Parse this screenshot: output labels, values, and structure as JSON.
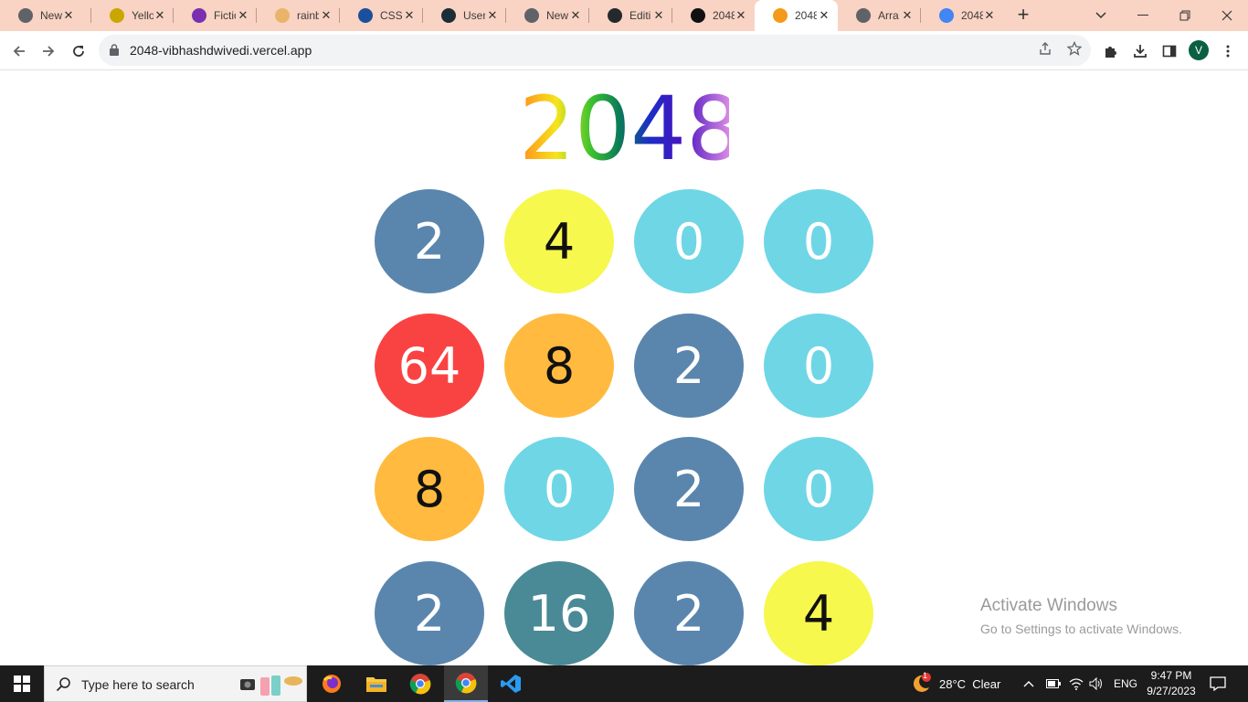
{
  "browser": {
    "tabs": [
      {
        "title": "New",
        "favicon": "chrome-icon",
        "color": "#5f6368"
      },
      {
        "title": "Yello",
        "favicon": "yellow-app-icon",
        "color": "#c8a800"
      },
      {
        "title": "Fictio",
        "favicon": "fiction-icon",
        "color": "#7a2fb0"
      },
      {
        "title": "rainb",
        "favicon": "rainbow-icon",
        "color": "#e9b46a"
      },
      {
        "title": "CSS",
        "favicon": "css-icon",
        "color": "#1b4f9c"
      },
      {
        "title": "User",
        "favicon": "user-icon",
        "color": "#1c2d3a"
      },
      {
        "title": "New",
        "favicon": "chrome-icon",
        "color": "#5f6368"
      },
      {
        "title": "Editi",
        "favicon": "github-icon",
        "color": "#24292e"
      },
      {
        "title": "2048",
        "favicon": "vercel-icon",
        "color": "#111111"
      },
      {
        "title": "2048",
        "favicon": "2048-icon",
        "color": "#f49a18",
        "active": true
      },
      {
        "title": "Arra",
        "favicon": "globe-icon",
        "color": "#5f6368"
      },
      {
        "title": "2048",
        "favicon": "google-icon",
        "color": "#4285f4"
      }
    ],
    "url": "2048-vibhashdwivedi.vercel.app",
    "profile_initial": "V"
  },
  "game": {
    "title": "2048",
    "tiles": [
      [
        "2",
        "4",
        "0",
        "0"
      ],
      [
        "64",
        "8",
        "2",
        "0"
      ],
      [
        "8",
        "0",
        "2",
        "0"
      ],
      [
        "2",
        "16",
        "2",
        "4"
      ]
    ],
    "tile_colors": {
      "0": {
        "bg": "#6fd6e6",
        "fg": "#ffffff"
      },
      "2": {
        "bg": "#5a86ae",
        "fg": "#ffffff"
      },
      "4": {
        "bg": "#f6f84d",
        "fg": "#111111"
      },
      "8": {
        "bg": "#ffba3f",
        "fg": "#111111"
      },
      "16": {
        "bg": "#4a8a96",
        "fg": "#ffffff"
      },
      "64": {
        "bg": "#f94343",
        "fg": "#ffffff"
      }
    }
  },
  "watermark": {
    "line1": "Activate Windows",
    "line2": "Go to Settings to activate Windows."
  },
  "taskbar": {
    "search_placeholder": "Type here to search",
    "weather": "28°C  Clear",
    "weather_badge": "1",
    "language": "ENG",
    "time": "9:47 PM",
    "date": "9/27/2023"
  }
}
